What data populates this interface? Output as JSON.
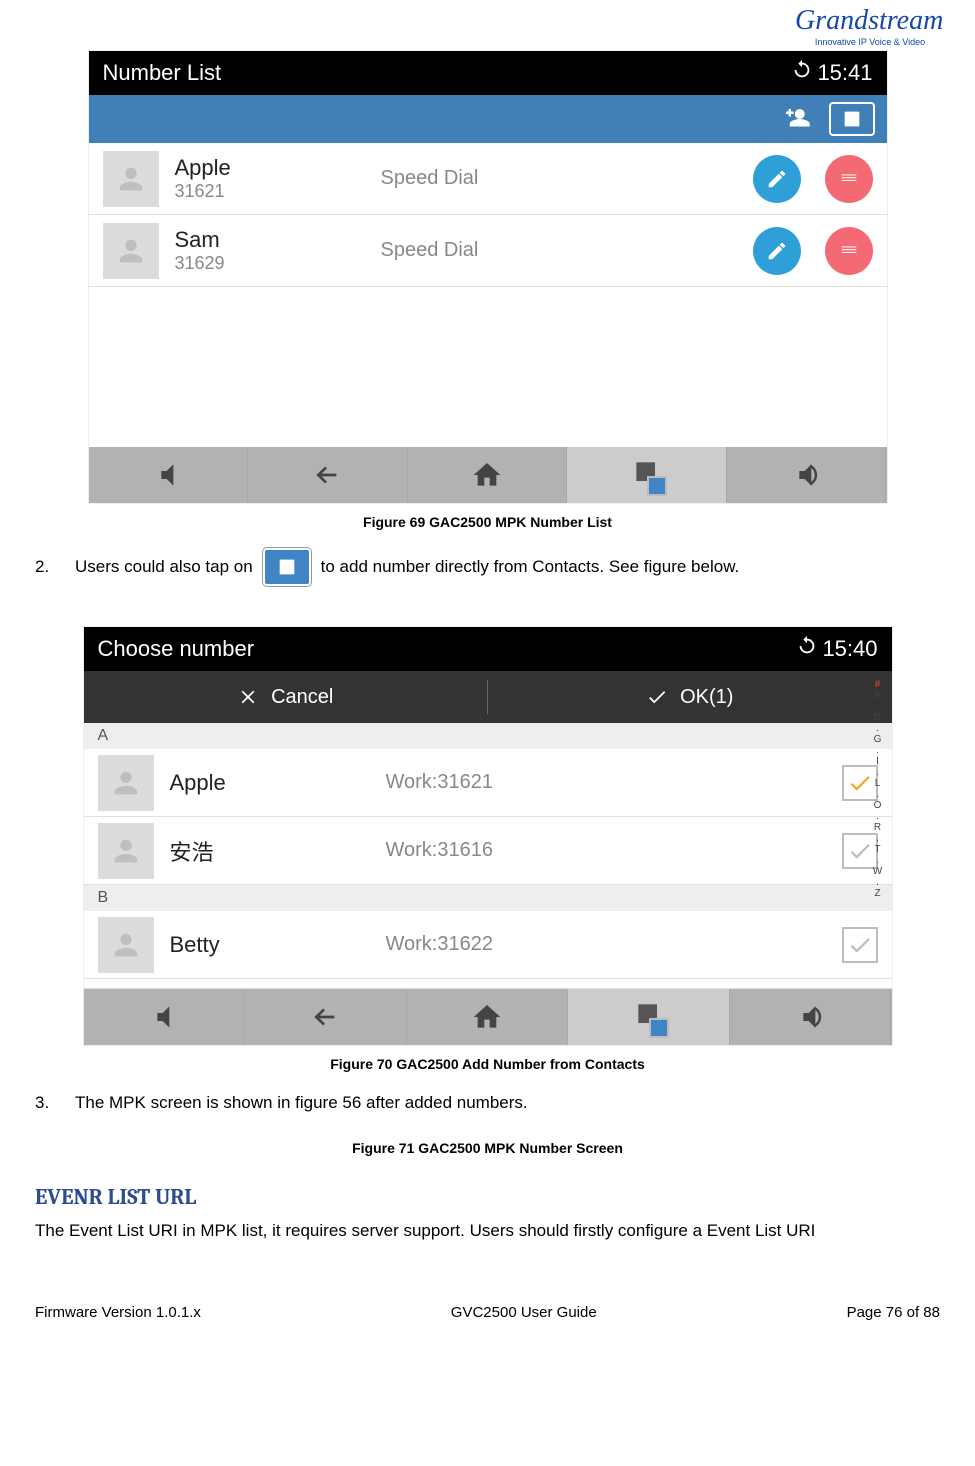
{
  "logo": {
    "brand": "Grandstream",
    "tagline": "Innovative IP Voice & Video"
  },
  "fig1": {
    "caption": "Figure 69 GAC2500 MPK Number List",
    "title": "Number List",
    "time": "15:41",
    "rows": [
      {
        "name": "Apple",
        "num": "31621",
        "mode": "Speed Dial"
      },
      {
        "name": "Sam",
        "num": "31629",
        "mode": "Speed Dial"
      }
    ]
  },
  "step2": {
    "num": "2.",
    "pre": "Users could also tap on",
    "post": "to add number directly from Contacts. See figure below."
  },
  "fig2": {
    "caption": "Figure 70 GAC2500 Add Number from Contacts",
    "title": "Choose number",
    "time": "15:40",
    "cancel": "Cancel",
    "ok": "OK(1)",
    "sectionA": "A",
    "sectionB": "B",
    "contacts": [
      {
        "name": "Apple",
        "work": "Work:31621",
        "checked": true
      },
      {
        "name": "安浩",
        "work": "Work:31616",
        "checked": false
      },
      {
        "name": "Betty",
        "work": "Work:31622",
        "checked": false
      }
    ],
    "index": [
      "#",
      "A",
      ".",
      "D",
      ".",
      "G",
      ".",
      "I",
      ".",
      "L",
      ".",
      "O",
      ".",
      "R",
      ".",
      "T",
      ".",
      "W",
      ".",
      "Z"
    ]
  },
  "step3": {
    "num": "3.",
    "text": "The MPK screen is shown in figure 56 after added numbers."
  },
  "fig3_caption": "Figure 71 GAC2500 MPK Number Screen",
  "heading": "EVENR LIST URL",
  "body": "The Event List URI in MPK list, it requires server support. Users should firstly configure a Event List URI",
  "footer": {
    "left": "Firmware Version 1.0.1.x",
    "mid": "GVC2500 User Guide",
    "right": "Page 76 of 88"
  }
}
